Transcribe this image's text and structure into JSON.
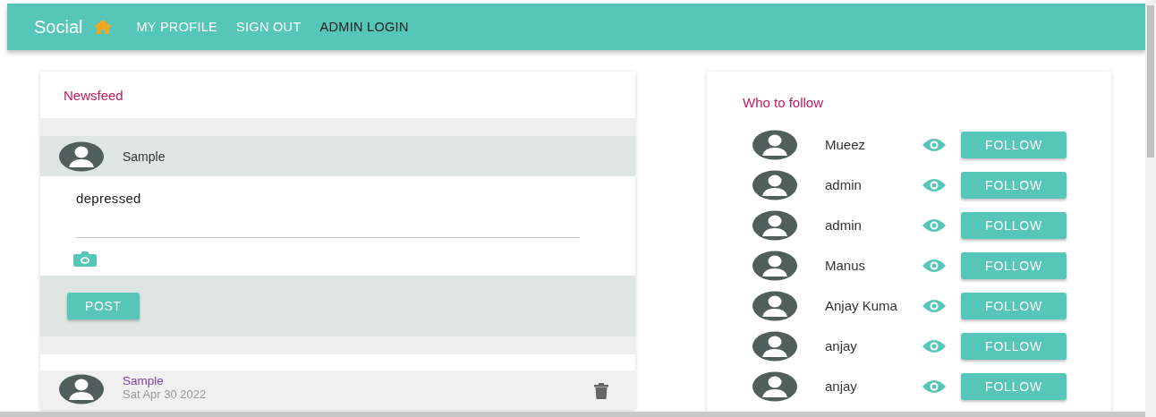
{
  "navbar": {
    "brand": "Social",
    "links": [
      {
        "label": "MY PROFILE",
        "selected": false
      },
      {
        "label": "SIGN OUT",
        "selected": false
      },
      {
        "label": "ADMIN LOGIN",
        "selected": true
      }
    ]
  },
  "newsfeed": {
    "title": "Newsfeed",
    "composer": {
      "user": "Sample",
      "value": "depressed",
      "button": "POST"
    },
    "posts": [
      {
        "user": "Sample",
        "date": "Sat Apr 30 2022"
      }
    ]
  },
  "who_to_follow": {
    "title": "Who to follow",
    "users": [
      {
        "name": "Mueez",
        "button": "FOLLOW"
      },
      {
        "name": "admin",
        "button": "FOLLOW"
      },
      {
        "name": "admin",
        "button": "FOLLOW"
      },
      {
        "name": "Manus",
        "button": "FOLLOW"
      },
      {
        "name": "Anjay Kuma",
        "button": "FOLLOW"
      },
      {
        "name": "anjay",
        "button": "FOLLOW"
      },
      {
        "name": "anjay",
        "button": "FOLLOW"
      }
    ]
  }
}
